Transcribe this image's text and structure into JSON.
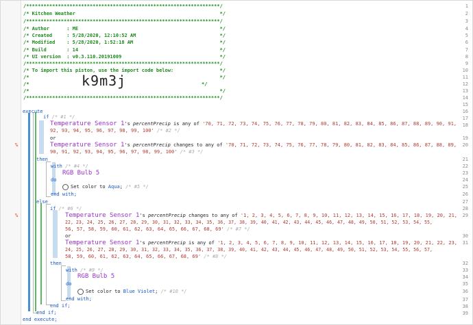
{
  "header": {
    "l1": "/*******************************************************************/",
    "l2": "/* Kitchen Weather                                                  */",
    "l3": "/*******************************************************************/",
    "l4": "/* Author      : ME                                                 */",
    "l5": "/* Created     : 5/28/2020, 12:10:52 AM                             */",
    "l6": "/* Modified    : 5/28/2020, 1:52:18 AM                              */",
    "l7": "/* Build       : 14                                                 */",
    "l8": "/* UI version  : v0.3.110.20191009                                  */",
    "l9": "/*******************************************************************/",
    "l10": "/* To import this piston, use the import code below:                */",
    "l11": "/*                                                                  */",
    "l12": "/*",
    "l12_end": "*/",
    "l13": "/*                                                                  */",
    "l14": "/*******************************************************************/",
    "import_code": "k9m3j"
  },
  "line_numbers": [
    "1",
    "2",
    "3",
    "4",
    "5",
    "6",
    "7",
    "8",
    "9",
    "10",
    "11",
    "12",
    "13",
    "14",
    "15",
    "16",
    "17",
    "18",
    "19",
    "20",
    "21",
    "22",
    "23",
    "24",
    "25",
    "26",
    "27",
    "28",
    "29",
    "30",
    "31",
    "32",
    "33",
    "34",
    "35",
    "36",
    "37",
    "38",
    "39"
  ],
  "warn_mark": "%",
  "code": {
    "execute": "execute",
    "if_kw": "if",
    "c1": "/* #1 */",
    "dev_temp": "Temperature Sensor 1",
    "apos_s": "'s",
    "attr": "percentPrecip",
    "is_any_of": "is any of",
    "changes_to_any_of": "changes to any of",
    "list_high_a": "'70, 71, 72, 73, 74, 75, 76, 77, 78, 79, 80, 81, 82, 83, 84, 85, 86, 87, 88, 89, 90, 91,",
    "list_high_b": "92, 93, 94, 95, 96, 97, 98, 99, 100'",
    "c2": "/* #2 */",
    "or_kw": "or",
    "list_high2_a": "'70, 71, 72, 73, 74, 75, 76, 77, 78, 79, 80, 81, 82, 83, 84, 85, 86, 87, 88, 89,",
    "list_high2_b": "90, 91, 92, 93, 94, 95, 96, 97, 98, 99, 100'",
    "c3": "/* #3 */",
    "then_kw": "then",
    "with_kw": "with",
    "c4": "/* #4 */",
    "dev_bulb": "RGB Bulb 5",
    "do_kw": "do",
    "set_color_to": "Set color to",
    "aqua": "Aqua",
    "semi": ";",
    "c5": "/* #5 */",
    "end_with": "end with;",
    "else_kw": "else",
    "c6": "/* #6 */",
    "list_low_a": "'1, 2, 3, 4, 5, 6, 7, 8, 9, 10, 11, 12, 13, 14, 15, 16, 17, 18, 19, 20, 21,",
    "list_low_b": "22, 23, 24, 25, 26, 27, 28, 29, 30, 31, 32, 33, 34, 35, 36, 37, 38, 39, 40, 41, 42, 43, 44, 45, 46, 47, 48, 49, 50, 51, 52, 53, 54, 55,",
    "list_low_c": "56, 57, 58, 59, 60, 61, 62, 63, 64, 65, 66, 67, 68, 69'",
    "c7": "/* #7 */",
    "list_low2_a": "'1, 2, 3, 4, 5, 6, 7, 8, 9, 10, 11, 12, 13, 14, 15, 16, 17, 18, 19, 20, 21, 22, 23,",
    "list_low2_b": "24, 25, 26, 27, 28, 29, 30, 31, 32, 33, 34, 35, 36, 37, 38, 39, 40, 41, 42, 43, 44, 45, 46, 47, 48, 49, 50, 51, 52, 53, 54, 55, 56, 57,",
    "list_low2_c": "58, 59, 60, 61, 62, 63, 64, 65, 66, 67, 68, 69'",
    "c8": "/* #8 */",
    "c9": "/* #9 */",
    "blue_violet": "Blue Violet",
    "c10": "/* #10 */",
    "end_if": "end if;",
    "end_execute": "end execute;"
  },
  "colors": {
    "comment": "#1a8a1a",
    "keyword": "#1155cc",
    "device": "#9a2ecc",
    "string": "#b0392e",
    "warning": "#e0601c"
  }
}
